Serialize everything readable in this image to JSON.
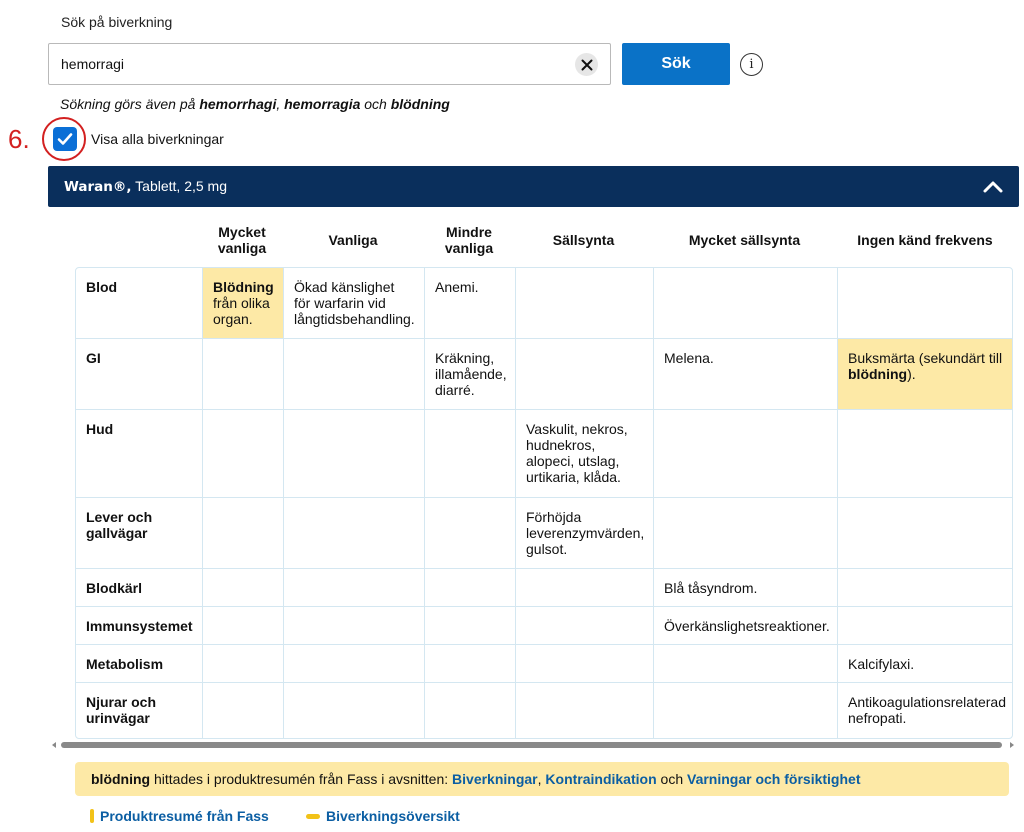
{
  "search": {
    "label": "Sök på biverkning",
    "value": "hemorragi",
    "button_label": "Sök",
    "note_prefix": "Sökning görs även på ",
    "note_term1": "hemorrhagi",
    "note_sep1": ", ",
    "note_term2": "hemorragia",
    "note_sep2": " och ",
    "note_term3": "blödning"
  },
  "annotation": {
    "step": "6."
  },
  "show_all": {
    "label": "Visa alla biverkningar",
    "checked": true
  },
  "product": {
    "brand": "Waran®,",
    "form": " Tablett, 2,5 mg"
  },
  "table": {
    "columns": [
      "Mycket vanliga",
      "Vanliga",
      "Mindre vanliga",
      "Sällsynta",
      "Mycket sällsynta",
      "Ingen känd frekvens"
    ],
    "rows": [
      {
        "organ": "Blod",
        "cells": [
          "",
          "Ökad känslighet för warfarin vid långtidsbehandling.",
          "Anemi.",
          "",
          "",
          ""
        ]
      },
      {
        "organ": "GI",
        "cells": [
          "",
          "",
          "Kräkning, illamående, diarré.",
          "",
          "Melena.",
          ""
        ]
      },
      {
        "organ": "Hud",
        "cells": [
          "",
          "",
          "",
          "Vaskulit, nekros, hudnekros, alopeci, utslag, urtikaria, klåda.",
          "",
          ""
        ]
      },
      {
        "organ": "Lever och gallvägar",
        "cells": [
          "",
          "",
          "",
          "Förhöjda leverenzymvärden, gulsot.",
          "",
          ""
        ]
      },
      {
        "organ": "Blodkärl",
        "cells": [
          "",
          "",
          "",
          "",
          "Blå tåsyndrom.",
          ""
        ]
      },
      {
        "organ": "Immunsystemet",
        "cells": [
          "",
          "",
          "",
          "",
          "Överkänslighetsreaktioner.",
          ""
        ]
      },
      {
        "organ": "Metabolism",
        "cells": [
          "",
          "",
          "",
          "",
          "",
          "Kalcifylaxi."
        ]
      },
      {
        "organ": "Njurar och urinvägar",
        "cells": [
          "",
          "",
          "",
          "",
          "",
          "Antikoagulationsrelaterad nefropati."
        ]
      }
    ],
    "highlight_blod": {
      "bold": "Blödning",
      "rest": " från olika organ."
    },
    "highlight_gi": {
      "prefix": "Buksmärta (sekundärt till ",
      "bold": "blödning",
      "suffix": ")."
    }
  },
  "banner": {
    "keyword": "blödning",
    "text": " hittades i produktresumén från Fass i avsnitten: ",
    "link1": "Biverkningar",
    "sep1": ", ",
    "link2": "Kontraindikation",
    "sep2": " och ",
    "link3": "Varningar och försiktighet"
  },
  "footer": {
    "link1": "Produktresumé från Fass",
    "link2": "Biverkningsöversikt"
  },
  "colors": {
    "primary_button": "#0a72c7",
    "product_bar": "#0a2f5c",
    "highlight": "#fde9a6",
    "link": "#0b5ea3",
    "annotation": "#d32020"
  }
}
